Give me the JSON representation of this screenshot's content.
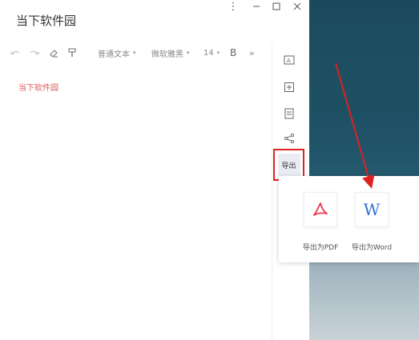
{
  "window": {
    "title": "当下软件园",
    "controls": {
      "more_icon": "vertical-dots",
      "minimize_icon": "minimize",
      "maximize_icon": "maximize",
      "close_icon": "close"
    }
  },
  "toolbar": {
    "paragraph_style": "普通文本",
    "font_family": "微软雅黑",
    "font_size": "14",
    "bold_label": "B",
    "more_label": "»",
    "caret": "▾"
  },
  "document": {
    "body_text": "当下软件园",
    "text_color": "#e05a5a"
  },
  "sidebar": {
    "export_label": "导出"
  },
  "export_menu": {
    "pdf_label": "导出为PDF",
    "word_label": "导出为Word",
    "word_glyph": "W",
    "pdf_color": "#e8384f",
    "word_color": "#2f6fd0"
  },
  "annotation": {
    "highlight_color": "#e02020"
  }
}
